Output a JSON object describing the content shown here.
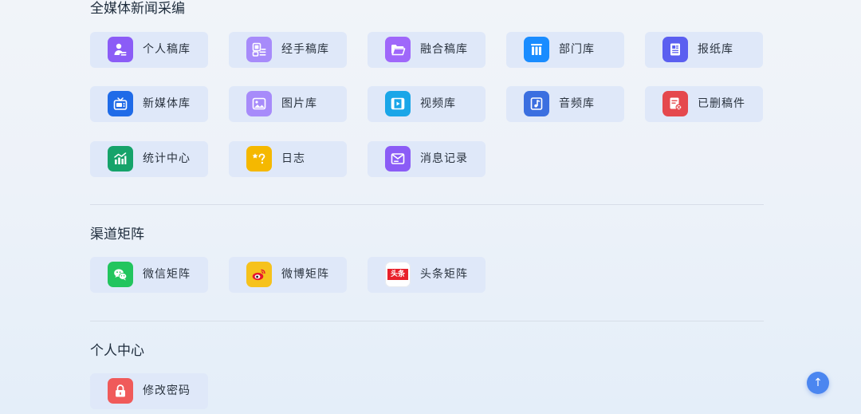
{
  "sections": [
    {
      "title": "全媒体新闻采编",
      "items": [
        {
          "label": "个人稿库",
          "icon": "person-doc-icon",
          "color": "#8b5cf6"
        },
        {
          "label": "经手稿库",
          "icon": "handled-doc-icon",
          "color": "#a78bfa"
        },
        {
          "label": "融合稿库",
          "icon": "folder-open-icon",
          "color": "#9f67fa"
        },
        {
          "label": "部门库",
          "icon": "library-books-icon",
          "color": "#1a8cff"
        },
        {
          "label": "报纸库",
          "icon": "newspaper-icon",
          "color": "#5b5ff0"
        },
        {
          "label": "新媒体库",
          "icon": "new-media-icon",
          "color": "#1f6be8"
        },
        {
          "label": "图片库",
          "icon": "image-icon",
          "color": "#a78bfa"
        },
        {
          "label": "视频库",
          "icon": "video-film-icon",
          "color": "#1aa6e8"
        },
        {
          "label": "音频库",
          "icon": "audio-file-icon",
          "color": "#3b6fe0"
        },
        {
          "label": "已删稿件",
          "icon": "deleted-doc-icon",
          "color": "#e5484d"
        },
        {
          "label": "统计中心",
          "icon": "bar-chart-icon",
          "color": "#16a36a"
        },
        {
          "label": "日志",
          "icon": "log-star-icon",
          "color": "#f5b800"
        },
        {
          "label": "消息记录",
          "icon": "message-envelope-icon",
          "color": "#8b5cf6"
        }
      ]
    },
    {
      "title": "渠道矩阵",
      "items": [
        {
          "label": "微信矩阵",
          "icon": "wechat-icon",
          "color": "#22c55e"
        },
        {
          "label": "微博矩阵",
          "icon": "weibo-icon",
          "color": "#f6c21c"
        },
        {
          "label": "头条矩阵",
          "icon": "toutiao-icon",
          "color": "#ffffff"
        }
      ]
    },
    {
      "title": "个人中心",
      "items": [
        {
          "label": "修改密码",
          "icon": "lock-icon",
          "color": "#f05a5a"
        }
      ]
    }
  ],
  "toutiao_logo_text": "头条",
  "back_to_top": "↑"
}
